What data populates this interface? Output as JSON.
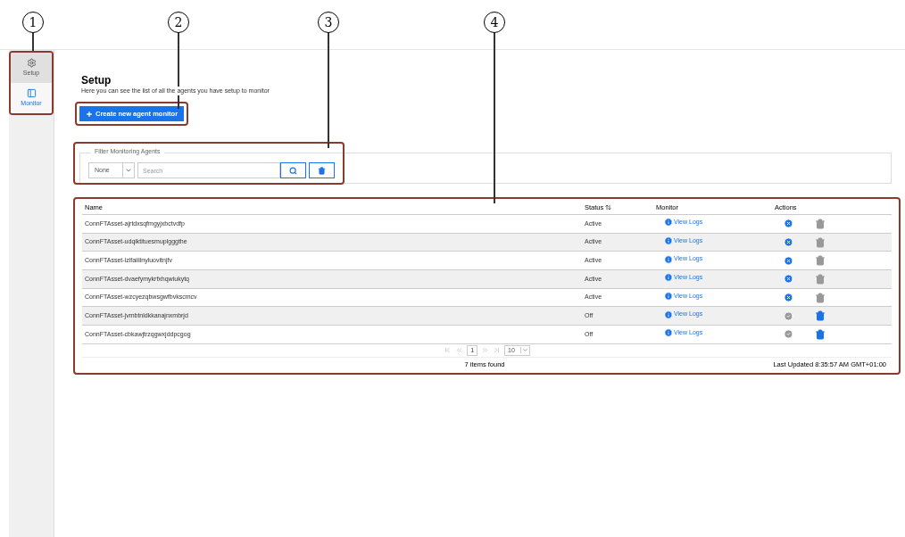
{
  "callouts": [
    "1",
    "2",
    "3",
    "4"
  ],
  "sidebar": {
    "items": [
      {
        "label": "Setup",
        "kind": "gear",
        "selected": true
      },
      {
        "label": "Monitor",
        "kind": "panel",
        "selected": false
      }
    ]
  },
  "page": {
    "title": "Setup",
    "subtitle": "Here you can see the list of all the agents you have setup to monitor",
    "create_button": "Create new agent monitor"
  },
  "filter": {
    "legend": "Filter Monitoring Agents",
    "dropdown": "None",
    "search_placeholder": "Search"
  },
  "table": {
    "columns": [
      {
        "label": "Name",
        "sortable": false
      },
      {
        "label": "Status",
        "sortable": true
      },
      {
        "label": "Monitor",
        "sortable": false
      },
      {
        "label": "Actions",
        "sortable": false
      }
    ],
    "rows": [
      {
        "name": "ConnFTAsset-ajrtdxsqfmgyjxbctvdfp",
        "status": "Active",
        "link": "View Logs",
        "running": true,
        "delete_disabled": true
      },
      {
        "name": "ConnFTAsset-udqiktituesmuplgggthe",
        "status": "Active",
        "link": "View Logs",
        "running": true,
        "delete_disabled": true
      },
      {
        "name": "ConnFTAsset-lzifaiiiinyluovitnjfv",
        "status": "Active",
        "link": "View Logs",
        "running": true,
        "delete_disabled": true
      },
      {
        "name": "ConnFTAsset-dvaefymykrfxhqwiukytq",
        "status": "Active",
        "link": "View Logs",
        "running": true,
        "delete_disabled": true
      },
      {
        "name": "ConnFTAsset-wzcyezqbwsgwfbvkscmcv",
        "status": "Active",
        "link": "View Logs",
        "running": true,
        "delete_disabled": true
      },
      {
        "name": "ConnFTAsset-jvmbtnldkkanajnxmbrjd",
        "status": "Off",
        "link": "View Logs",
        "running": false,
        "delete_disabled": false
      },
      {
        "name": "ConnFTAsset-cbkawjtrzqgwxjddpcgog",
        "status": "Off",
        "link": "View Logs",
        "running": false,
        "delete_disabled": false
      }
    ],
    "pagination": {
      "page": "1",
      "page_size": "10"
    },
    "count": "7 items found",
    "last_updated": "Last Updated 8:35:57 AM GMT+01:00"
  }
}
